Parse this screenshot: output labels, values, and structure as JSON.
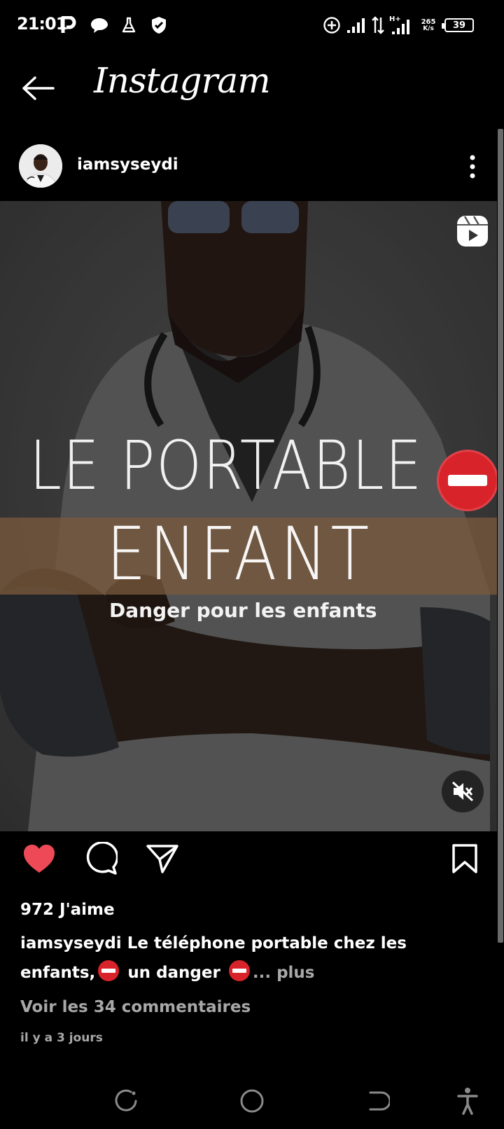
{
  "status_bar": {
    "time": "21:01",
    "network_speed": "265",
    "network_speed_unit": "K/s",
    "battery": "39",
    "network_type": "H+"
  },
  "header": {
    "title": "Instagram"
  },
  "post": {
    "username": "iamsyseydi",
    "media": {
      "title_line1": "LE PORTABLE",
      "title_line2": "ENFANT",
      "subtitle": "Danger pour les enfants"
    },
    "likes": "972 J'aime",
    "caption_user": "iamsyseydi",
    "caption_text_1": "Le téléphone portable chez les enfants,",
    "caption_text_2": "un danger",
    "caption_more": "... plus",
    "comments_link": "Voir les 34 commentaires",
    "time_ago": "il y a 3 jours",
    "liked": true
  },
  "colors": {
    "like_red": "#ed4956",
    "background": "#000000",
    "secondary_text": "#a8a8a8"
  },
  "icons": {
    "back": "arrow-left-icon",
    "more": "more-vertical-icon",
    "reels": "reels-icon",
    "mute": "muted-speaker-icon",
    "like": "heart-icon",
    "comment": "comment-icon",
    "share": "send-icon",
    "save": "bookmark-icon"
  }
}
